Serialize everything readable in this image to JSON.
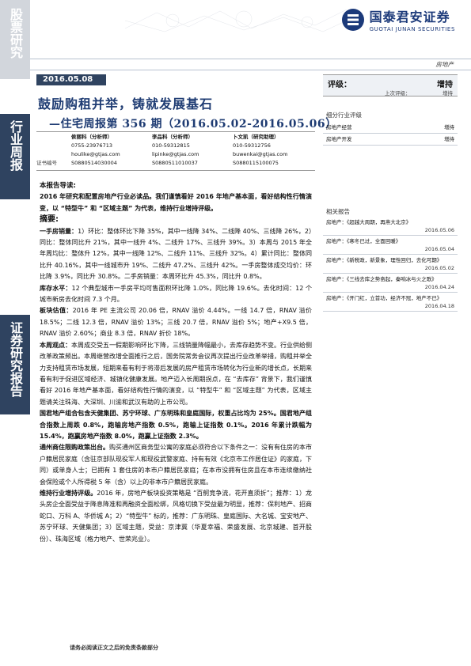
{
  "sidebar": {
    "top_label": "股票研究",
    "mid_label": "行业周报",
    "bottom_label": "证券研究报告"
  },
  "header": {
    "logo_cn": "国泰君安证券",
    "logo_en": "GUOTAI JUNAN SECURITIES",
    "section_tag": "房地产"
  },
  "report": {
    "date": "2016.05.08",
    "title": "鼓励购租并举，铸就发展基石",
    "subtitle": "—住宅周报第 356 期（2016.05.02-2016.05.06）"
  },
  "analysts": {
    "names": [
      "侯丽科（分析师）",
      "李品科（分析师）",
      "卜文凯（研究助理）"
    ],
    "phones": [
      "0755-23976713",
      "010-59312815",
      "010-59312756"
    ],
    "emails": [
      "houlike@gtjas.com",
      "lipinke@gtjas.com",
      "buwenkai@gtjas.com"
    ],
    "cert_label": "证书编号",
    "certs": [
      "S0880514030004",
      "S0880511010037",
      "S0880115100075"
    ]
  },
  "rating": {
    "label": "评级：",
    "value": "增持",
    "prev_label": "上次评级：",
    "prev_value": "增持"
  },
  "sub_industry": {
    "title": "细分行业评级",
    "rows": [
      {
        "name": "房地产经营",
        "rating": "增持"
      },
      {
        "name": "房地产开发",
        "rating": "增持"
      }
    ]
  },
  "related": {
    "title": "相关报告",
    "items": [
      {
        "text": "房地产：《超越大周期，再燕大北京》",
        "date": "2016.05.06"
      },
      {
        "text": "房地产：《寒冬已过，全面回暖》",
        "date": "2016.05.04"
      },
      {
        "text": "房地产：《新税政，新景象，理性回归，去化可期》",
        "date": "2016.05.02"
      },
      {
        "text": "房地产：《三线去库之势奋起，秦响冰与火之歌》",
        "date": "2016.04.24"
      },
      {
        "text": "房地产：《开门红，立首功，经济不冠，地产不已》",
        "date": "2016.04.18"
      }
    ]
  },
  "body": {
    "guide_label": "本报告导读:",
    "guide_text": "2016 年研究和配置房地产行业必读品。我们谨慎看好 2016 年地产基本面，看好结构性行情演变，以 “特型牛” 和 “区域主题” 为代表，维持行业增持评级。",
    "abstract_label": "摘要:",
    "p1_lead": "一手房销量：",
    "p1_text": "1）环比：整体环比下降 35%，其中一线降 34%、二线降 40%、三线降 26%，2）同比：整体同比升 21%，其中一线升 4%、二线升 17%、三线升 39%。3）本周与 2015 年全年周均比：整体升 12%，其中一线降 12%、二线升 11%、三线升 32%。4）累计同比：整体同比升 40.16%，其中一线城市升 19%、二线升 47.2%、三线升 42%。一手房整体成交均价：环比降 3.9%，同比升 30.8%。二手房销量：本周环比升 45.3%，同比升 0.8%。",
    "p2_lead": "库存水平：",
    "p2_text": "12 个典型城市一手房平均可售面积环比降 1.0%，同比降 19.6%。去化时间：12 个城市新房去化时间 7.3 个月。",
    "p3_lead": "板块估值：",
    "p3_text": "2016 年 PE 主流公司 20.06 倍，RNAV 溢价 4.44%。一线 14.7 倍，RNAV 溢价 18.5%；二线 12.3 倍，RNAV 溢价 13%；三线 20.7 倍，RNAV 溢价 5%；地产+X9.5 倍，RNAV 溢价 2.60%；商业 8.3 倍，RNAV 折价 18%。",
    "p4_lead": "本周观点：",
    "p4_text": "本周成交受五一假期影响环比下降，三线销量降幅最小，去库存趋势不变。行业供给侧改革政策频出。本周继营改增全面推行之后，国务院常务会议再次提出行业改革举措，购租并举全力支持租赁市场发展，短期来看有利于将滞后发展的房产租赁市场转化为行业新的增长点，长期来看有利于促进区域经济、城镇化健康发展。地产迈入长周期拐点，在 “去库存” 背景下，我们谨慎看好 2016 年地产基本面，看好结构性行情的演变，以 “特型牛” 和 “区域主题” 为代表，区域主题请关注珠海、大深圳、川渝和武汉有助的上市公司。",
    "p5_text": "国君地产组合包含天健集团、苏宁环球、广东明珠和皇庭国际，权重占比均为 25%。国君地产组合指数上周跌 0.8%，跑输房地产指数 0.5%，跑输上证指数 0.1%。2016 年累计跌幅为 15.4%，跑赢房地产指数 8.0%，跑赢上证指数 2.3%。",
    "p6_lead": "通州商住限购政策出台。",
    "p6_text": "购买通州区商务型公寓的家庭必须符合以下条件之一：没有有住房的本市户籍居民家庭（含驻京部队现役军人和现役武警家庭、持有有效《北京市工作居住证》的家庭，下同）或单身人士；已拥有 1 套住房的本市户籍居民家庭；在本市没拥有住房且在本市连续缴纳社会保险或个人所得税 5 年（含）以上的非本市户籍居民家庭。",
    "p7_lead": "维持行业增持评级。",
    "p7_text": "2016 年，房地产板块投资策略是 “百舸竞争流，花开直须折”；推荐：1）龙头房企全面受益于降息降准和再融资全面松绑，风格切换下受益最为明显，推荐：保利地产、招商蛇口、万科 A、华侨城 A；2）“特型牛” 标的，推荐：广东明珠、皇庭国际、大名城、宝安地产、苏宁环球、天健集团；3）区域主题，受益：京津冀（华夏幸福、荣盛发展、北京城建、首开股份）、珠海区域（格力地产、世荣兆业）。"
  },
  "footer": {
    "text": "请务必阅读正文之后的免责条款部分"
  }
}
